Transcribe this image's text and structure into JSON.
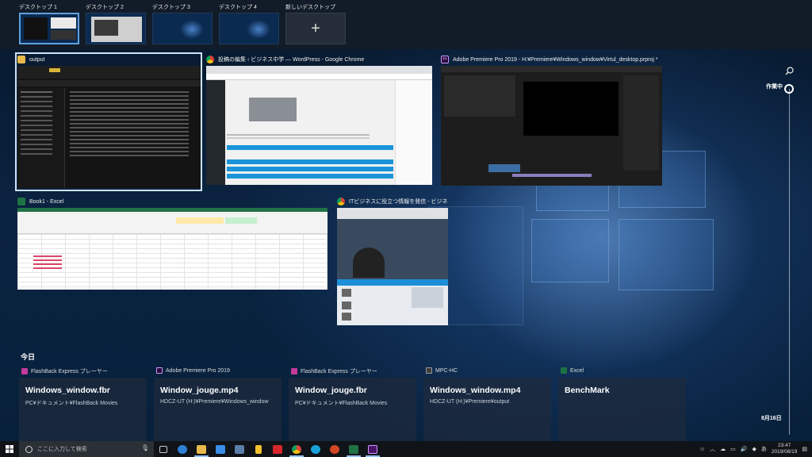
{
  "desktops": [
    {
      "label": "デスクトップ 1",
      "active": true
    },
    {
      "label": "デスクトップ 2",
      "active": false
    },
    {
      "label": "デスクトップ 3",
      "active": false
    },
    {
      "label": "デスクトップ 4",
      "active": false
    }
  ],
  "new_desktop": {
    "label": "新しいデスクトップ",
    "icon": "plus-icon"
  },
  "windows": {
    "output": {
      "title": "output",
      "icon": "folder-icon"
    },
    "chrome_wp": {
      "title": "投稿の編集 ‹ ビジネス中学 — WordPress - Google Chrome",
      "icon": "chrome-icon"
    },
    "premiere": {
      "title": "Adobe Premiere Pro 2019 - H:¥Premiere¥Windows_window¥Virtul_desktop.prproj *",
      "icon": "premiere-icon",
      "icon_text": "Pr"
    },
    "excel": {
      "title": "Book1 - Excel",
      "icon": "excel-icon"
    },
    "chrome_it": {
      "title": "ITビジネスに役立つ情報を発信 - ビジネ...",
      "icon": "chrome-icon"
    }
  },
  "timeline": {
    "section_label": "今日",
    "search_icon": "search-icon",
    "now_label": "作業中",
    "date_label": "8月16日",
    "cards": [
      {
        "app": "FlashBack Express プレーヤー",
        "app_icon": "flashback-icon",
        "title": "Windows_window.fbr",
        "path": "PC¥ドキュメント¥FlashBack Movies"
      },
      {
        "app": "Adobe Premiere Pro 2019",
        "app_icon": "premiere-icon",
        "title": "Window_jouge.mp4",
        "path": "HDCZ-UT (H:)¥Premiere¥Windows_window"
      },
      {
        "app": "FlashBack Express プレーヤー",
        "app_icon": "flashback-icon",
        "title": "Window_jouge.fbr",
        "path": "PC¥ドキュメント¥FlashBack Movies"
      },
      {
        "app": "MPC-HC",
        "app_icon": "mpc-icon",
        "title": "Windows_window.mp4",
        "path": "HDCZ-UT (H:)¥Premiere¥output"
      },
      {
        "app": "Excel",
        "app_icon": "excel-icon",
        "title": "BenchMark",
        "path": ""
      }
    ]
  },
  "taskbar": {
    "search_placeholder": "ここに入力して検索",
    "pinned": [
      {
        "name": "task-view-icon",
        "color": "#c8c8c8"
      },
      {
        "name": "edge-icon",
        "color": "#2f7fd6"
      },
      {
        "name": "explorer-icon",
        "color": "#e8b94a"
      },
      {
        "name": "store-icon",
        "color": "#3a8ee6"
      },
      {
        "name": "app-icon",
        "color": "#5a7ea8"
      },
      {
        "name": "bolt-icon",
        "color": "#f2c230"
      },
      {
        "name": "pdf-icon",
        "color": "#d8262b"
      },
      {
        "name": "chrome-icon",
        "color": "#db4437"
      },
      {
        "name": "teams-icon",
        "color": "#19a0d8"
      },
      {
        "name": "powerpoint-icon",
        "color": "#d24726"
      },
      {
        "name": "excel-icon",
        "color": "#1f7244"
      },
      {
        "name": "premiere-icon",
        "color": "#4a1466"
      }
    ],
    "time": "23:47",
    "date": "2019/08/19"
  }
}
